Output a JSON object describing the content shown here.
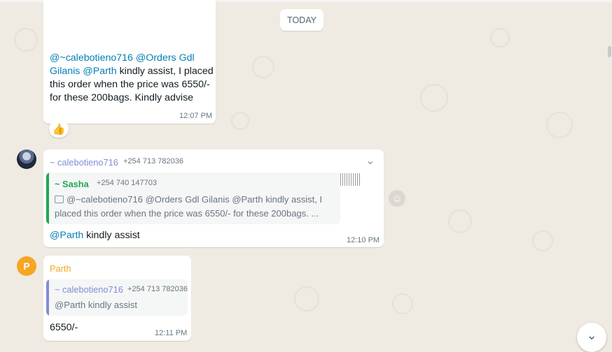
{
  "date_chip": "TODAY",
  "messages": [
    {
      "mention_line1_a": "@~calebotieno716",
      "mention_line1_b": "@Orders Gdl",
      "mention_line2_a": "Gilanis",
      "mention_line2_b": "@Parth",
      "text_line2": " kindly assist, I placed",
      "text_line3": "this order when the price was 6550/-",
      "text_line4": "for these 200bags. Kindly advise",
      "time": "12:07 PM",
      "reaction": "👍"
    },
    {
      "sender": "~ calebotieno716",
      "phone": "+254 713 782036",
      "quote_sender": "~ Sasha",
      "quote_phone": "+254 740 147703",
      "quote_line1": "@~calebotieno716 @Orders Gdl Gilanis @Parth kindly assist, I",
      "quote_line2": "placed this order when the price was 6550/- for these 200bags. ...",
      "mention": "@Parth",
      "text": " kindly assist",
      "time": "12:10 PM"
    },
    {
      "avatar_letter": "P",
      "sender": "Parth",
      "quote_sender": "~ calebotieno716",
      "quote_phone": "+254 713 782036",
      "quote_text": "@Parth kindly assist",
      "text": "6550/-",
      "time": "12:11 PM"
    }
  ],
  "colors": {
    "mention": "#027eb5",
    "sasha": "#1fa855",
    "caleb": "#7f8fd4",
    "parth": "#f5a623"
  },
  "icons": {
    "chevron": "chevron-down-icon",
    "camera": "camera-icon",
    "emoji": "emoji-icon"
  }
}
